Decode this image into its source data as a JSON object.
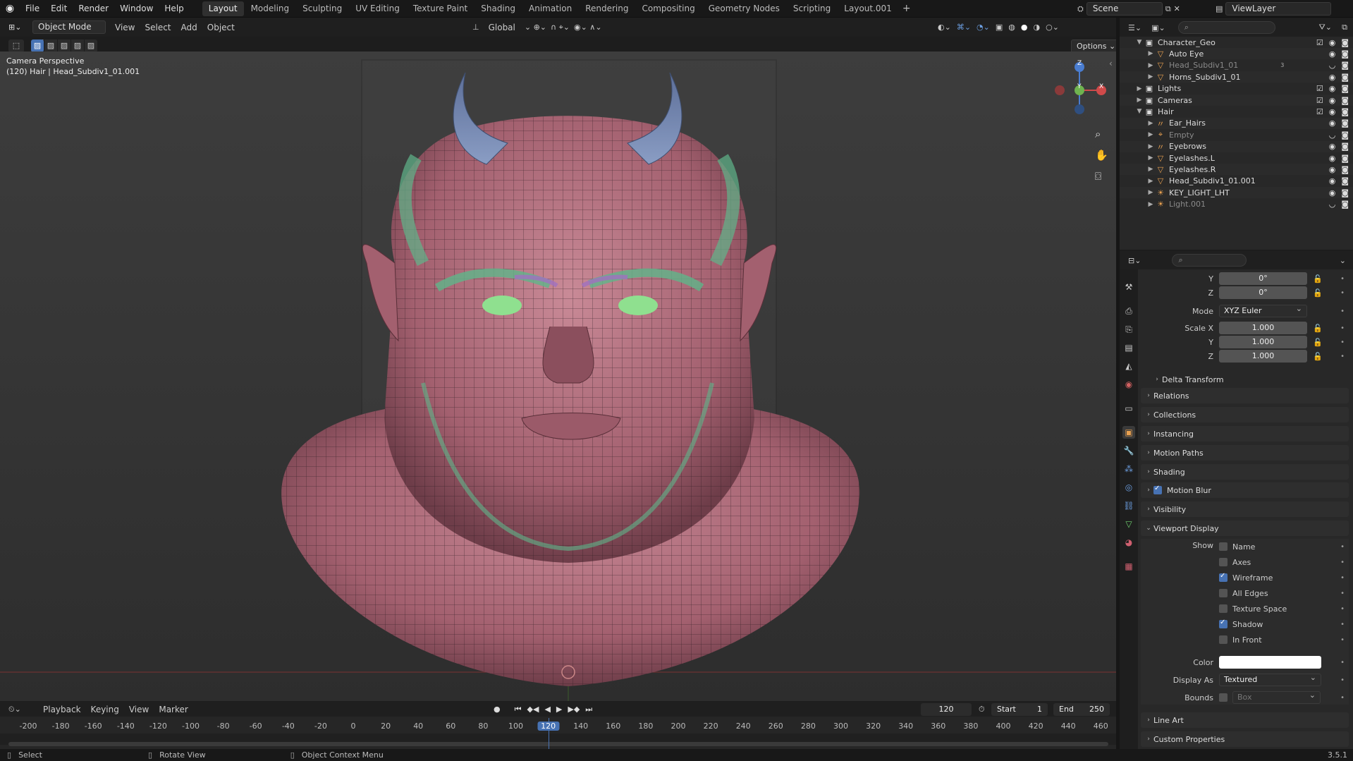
{
  "topbar": {
    "menus": [
      "File",
      "Edit",
      "Render",
      "Window",
      "Help"
    ],
    "workspaces": [
      "Layout",
      "Modeling",
      "Sculpting",
      "UV Editing",
      "Texture Paint",
      "Shading",
      "Animation",
      "Rendering",
      "Compositing",
      "Geometry Nodes",
      "Scripting",
      "Layout.001"
    ],
    "active_workspace": "Layout",
    "add_tab": "+",
    "scene": "Scene",
    "view_layer": "ViewLayer"
  },
  "viewport_header": {
    "mode": "Object Mode",
    "menus": [
      "View",
      "Select",
      "Add",
      "Object"
    ],
    "transform_orientation": "Global",
    "options": "Options"
  },
  "viewport": {
    "camera_label": "Camera Perspective",
    "object_label": "(120) Hair | Head_Subdiv1_01.001",
    "gizmo": {
      "x": "X",
      "y": "Y",
      "z": "Z"
    }
  },
  "outliner": {
    "rows": [
      {
        "label": "Character_Geo",
        "icon": "collection-icon",
        "level": 0,
        "expanded": true,
        "dim": false
      },
      {
        "label": "Auto Eye",
        "icon": "mesh-icon",
        "level": 1,
        "expanded": false,
        "dim": false
      },
      {
        "label": "Head_Subdiv1_01",
        "icon": "mesh-icon",
        "level": 1,
        "expanded": false,
        "dim": true,
        "badge": "3"
      },
      {
        "label": "Horns_Subdiv1_01",
        "icon": "mesh-icon",
        "level": 1,
        "expanded": false,
        "dim": false
      },
      {
        "label": "Lights",
        "icon": "collection-icon",
        "level": 0,
        "expanded": false,
        "dim": false
      },
      {
        "label": "Cameras",
        "icon": "collection-icon",
        "level": 0,
        "expanded": false,
        "dim": false
      },
      {
        "label": "Hair",
        "icon": "collection-icon",
        "level": 0,
        "expanded": true,
        "dim": false
      },
      {
        "label": "Ear_Hairs",
        "icon": "curves-icon",
        "level": 1,
        "expanded": false,
        "dim": false
      },
      {
        "label": "Empty",
        "icon": "empty-icon",
        "level": 1,
        "expanded": false,
        "dim": true
      },
      {
        "label": "Eyebrows",
        "icon": "curves-icon",
        "level": 1,
        "expanded": false,
        "dim": false
      },
      {
        "label": "Eyelashes.L",
        "icon": "mesh-icon",
        "level": 1,
        "expanded": false,
        "dim": false
      },
      {
        "label": "Eyelashes.R",
        "icon": "mesh-icon",
        "level": 1,
        "expanded": false,
        "dim": false
      },
      {
        "label": "Head_Subdiv1_01.001",
        "icon": "mesh-icon",
        "level": 1,
        "expanded": false,
        "dim": false
      },
      {
        "label": "KEY_LIGHT_LHT",
        "icon": "light-icon",
        "level": 1,
        "expanded": false,
        "dim": false
      },
      {
        "label": "Light.001",
        "icon": "light-icon",
        "level": 1,
        "expanded": false,
        "dim": true
      }
    ]
  },
  "properties": {
    "rotation_y_label": "Y",
    "rotation_y": "0°",
    "rotation_z_label": "Z",
    "rotation_z": "0°",
    "mode_label": "Mode",
    "mode_value": "XYZ Euler",
    "scale_x_label": "Scale X",
    "scale_x": "1.000",
    "scale_y_label": "Y",
    "scale_y": "1.000",
    "scale_z_label": "Z",
    "scale_z": "1.000",
    "delta_transform": "Delta Transform",
    "panels": [
      "Relations",
      "Collections",
      "Instancing",
      "Motion Paths",
      "Shading"
    ],
    "motion_blur": "Motion Blur",
    "visibility": "Visibility",
    "viewport_display": "Viewport Display",
    "show_label": "Show",
    "show_options": [
      {
        "label": "Name",
        "checked": false
      },
      {
        "label": "Axes",
        "checked": false
      },
      {
        "label": "Wireframe",
        "checked": true
      },
      {
        "label": "All Edges",
        "checked": false
      },
      {
        "label": "Texture Space",
        "checked": false
      },
      {
        "label": "Shadow",
        "checked": true
      },
      {
        "label": "In Front",
        "checked": false
      }
    ],
    "color_label": "Color",
    "color_value": "#ffffff",
    "display_as_label": "Display As",
    "display_as": "Textured",
    "bounds_label": "Bounds",
    "bounds_value": "Box",
    "line_art": "Line Art",
    "custom_properties": "Custom Properties"
  },
  "timeline": {
    "menus": [
      "Playback",
      "Keying",
      "View",
      "Marker"
    ],
    "current_frame": "120",
    "start_label": "Start",
    "start": "1",
    "end_label": "End",
    "end": "250",
    "ticks": [
      "-200",
      "-180",
      "-160",
      "-140",
      "-120",
      "-100",
      "-80",
      "-60",
      "-40",
      "-20",
      "0",
      "20",
      "40",
      "60",
      "80",
      "100",
      "120",
      "140",
      "160",
      "180",
      "200",
      "220",
      "240",
      "260",
      "280",
      "300",
      "320",
      "340",
      "360",
      "380",
      "400",
      "420",
      "440",
      "460"
    ]
  },
  "statusbar": {
    "select": "Select",
    "rotate": "Rotate View",
    "context": "Object Context Menu",
    "version": "3.5.1"
  },
  "colors": {
    "accent": "#4772b3",
    "active_frame": "#4772b3",
    "skin": "#b86f7e",
    "hair": "#5fb58a",
    "horn": "#7a8cb5",
    "eye": "#8fe08f"
  }
}
